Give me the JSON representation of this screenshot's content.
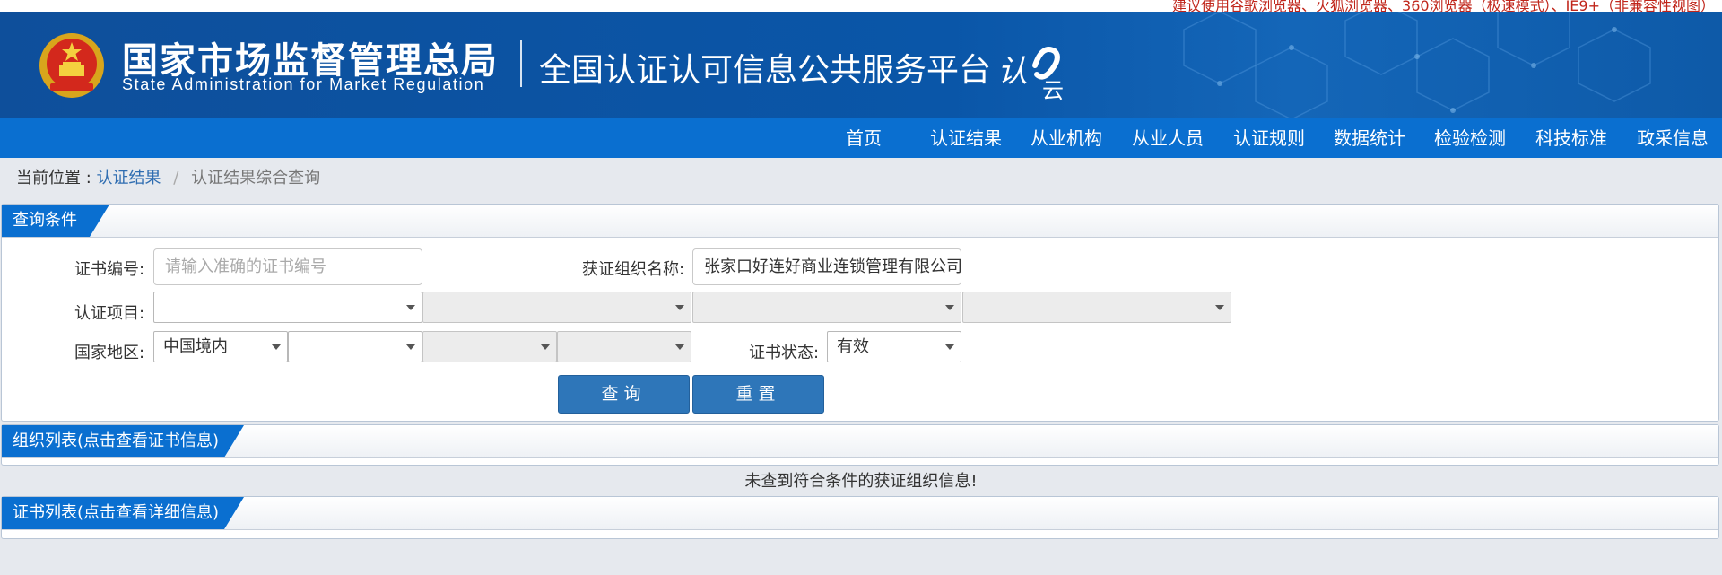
{
  "notice": "建议使用谷歌浏览器、火狐浏览器、360浏览器（极速模式）、IE9+（非兼容性视图）",
  "header": {
    "org_cn": "国家市场监督管理总局",
    "org_en": "State Administration  for  Market Regulation",
    "platform": "全国认证认可信息公共服务平台",
    "logo_text": "认云"
  },
  "nav": {
    "items": [
      "首页",
      "认证结果",
      "从业机构",
      "从业人员",
      "认证规则",
      "数据统计",
      "检验检测",
      "科技标准",
      "政采信息"
    ]
  },
  "breadcrumb": {
    "prefix": "当前位置 :",
    "link": "认证结果",
    "separator": "/",
    "current": "认证结果综合查询"
  },
  "query": {
    "title": "查询条件",
    "cert_no_label": "证书编号:",
    "cert_no_placeholder": "请输入准确的证书编号",
    "org_name_label": "获证组织名称:",
    "org_name_value": "张家口好连好商业连锁管理有限公司",
    "cert_item_label": "认证项目:",
    "region_label": "国家地区:",
    "region_value": "中国境内",
    "status_label": "证书状态:",
    "status_value": "有效",
    "search_button": "查询",
    "reset_button": "重置"
  },
  "org_list": {
    "title": "组织列表(点击查看证书信息)",
    "empty_message": "未查到符合条件的获证组织信息!"
  },
  "cert_list": {
    "title": "证书列表(点击查看详细信息)"
  },
  "colors": {
    "header_blue": "#0a56a8",
    "nav_blue": "#0a6fd0",
    "button_blue": "#2e76b9",
    "notice_red": "#c0261b",
    "link_blue": "#2f6db1"
  },
  "icons": [
    "national-emblem-icon",
    "cloud-logo-icon",
    "dropdown-caret-icon"
  ]
}
